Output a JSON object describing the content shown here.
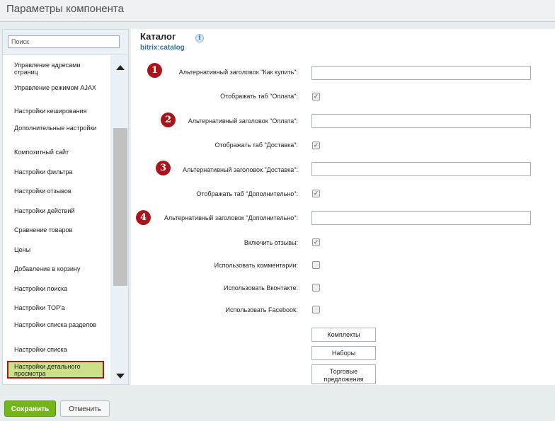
{
  "window": {
    "title": "Параметры компонента"
  },
  "search": {
    "placeholder": "Поиск"
  },
  "sidebar": {
    "items": [
      {
        "label": "Управление адресами страниц"
      },
      {
        "label": "Управление режимом AJAX"
      },
      {
        "label": "Настройки кеширования"
      },
      {
        "label": "Дополнительные настройки"
      },
      {
        "label": "Композитный сайт"
      },
      {
        "label": "Настройки фильтра"
      },
      {
        "label": "Настройки отзывов"
      },
      {
        "label": "Настройки действий"
      },
      {
        "label": "Сравнение товаров"
      },
      {
        "label": "Цены"
      },
      {
        "label": "Добавление в корзину"
      },
      {
        "label": "Настройки поиска"
      },
      {
        "label": "Настройки TOP'a"
      },
      {
        "label": "Настройки списка разделов"
      },
      {
        "label": "Настройки списка"
      },
      {
        "label": "Настройки детального просмотра",
        "active": true
      }
    ]
  },
  "component": {
    "title": "Каталог",
    "code": "bitrix:catalog",
    "info_icon": "info-icon"
  },
  "settings": {
    "rows": [
      {
        "label": "Альтернативный заголовок \"Как купить\":",
        "type": "text",
        "value": "",
        "marker": "1"
      },
      {
        "label": "Отображать таб \"Оплата\":",
        "type": "checkbox",
        "checked": true
      },
      {
        "label": "Альтернативный заголовок \"Оплата\":",
        "type": "text",
        "value": "",
        "marker": "2"
      },
      {
        "label": "Отображать таб \"Доставка\":",
        "type": "checkbox",
        "checked": true
      },
      {
        "label": "Альтернативный заголовок \"Доставка\":",
        "type": "text",
        "value": "",
        "marker": "3"
      },
      {
        "label": "Отображать таб \"Дополнительно\":",
        "type": "checkbox",
        "checked": true
      },
      {
        "label": "Альтернативный заголовок \"Дополнительно\":",
        "type": "text",
        "value": "",
        "marker": "4"
      },
      {
        "label": "Включить отзывы:",
        "type": "checkbox",
        "checked": true
      },
      {
        "label": "Использовать комментарии:",
        "type": "checkbox",
        "checked": false
      },
      {
        "label": "Использовать Вконтакте:",
        "type": "checkbox",
        "checked": false
      },
      {
        "label": "Использовать Facebook:",
        "type": "checkbox",
        "checked": false
      }
    ],
    "buttons": [
      {
        "label": "Комплекты"
      },
      {
        "label": "Наборы"
      },
      {
        "label": "Торговые предложения"
      }
    ]
  },
  "footer": {
    "save_label": "Сохранить",
    "cancel_label": "Отменить"
  },
  "colors": {
    "marker": "#a8141a",
    "save": "#74b51c",
    "active_item": "#cbe089",
    "active_border": "#a41a1f",
    "code": "#2a77a8"
  }
}
